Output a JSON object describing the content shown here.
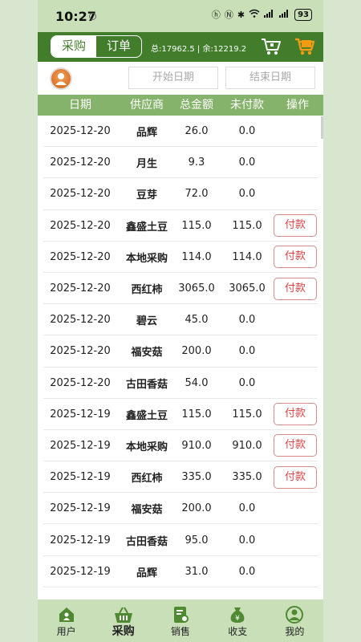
{
  "status_bar": {
    "time": "10:27",
    "battery": "93"
  },
  "header": {
    "tabs": [
      {
        "label": "采购",
        "active": true
      },
      {
        "label": "订单",
        "active": false
      }
    ],
    "summary": "总:17962.5 | 余:12219.2"
  },
  "filter": {
    "start_placeholder": "开始日期",
    "end_placeholder": "结束日期"
  },
  "table": {
    "columns": [
      "日期",
      "供应商",
      "总金额",
      "未付款",
      "操作"
    ],
    "pay_label": "付款",
    "rows": [
      {
        "date": "2025-12-20",
        "supplier": "品辉",
        "total": "26.0",
        "unpaid": "0.0",
        "pay": false
      },
      {
        "date": "2025-12-20",
        "supplier": "月生",
        "total": "9.3",
        "unpaid": "0.0",
        "pay": false
      },
      {
        "date": "2025-12-20",
        "supplier": "豆芽",
        "total": "72.0",
        "unpaid": "0.0",
        "pay": false
      },
      {
        "date": "2025-12-20",
        "supplier": "鑫盛土豆",
        "total": "115.0",
        "unpaid": "115.0",
        "pay": true
      },
      {
        "date": "2025-12-20",
        "supplier": "本地采购",
        "total": "114.0",
        "unpaid": "114.0",
        "pay": true
      },
      {
        "date": "2025-12-20",
        "supplier": "西红柿",
        "total": "3065.0",
        "unpaid": "3065.0",
        "pay": true
      },
      {
        "date": "2025-12-20",
        "supplier": "碧云",
        "total": "45.0",
        "unpaid": "0.0",
        "pay": false
      },
      {
        "date": "2025-12-20",
        "supplier": "福安菇",
        "total": "200.0",
        "unpaid": "0.0",
        "pay": false
      },
      {
        "date": "2025-12-20",
        "supplier": "古田香菇",
        "total": "54.0",
        "unpaid": "0.0",
        "pay": false
      },
      {
        "date": "2025-12-19",
        "supplier": "鑫盛土豆",
        "total": "115.0",
        "unpaid": "115.0",
        "pay": true
      },
      {
        "date": "2025-12-19",
        "supplier": "本地采购",
        "total": "910.0",
        "unpaid": "910.0",
        "pay": true
      },
      {
        "date": "2025-12-19",
        "supplier": "西红柿",
        "total": "335.0",
        "unpaid": "335.0",
        "pay": true
      },
      {
        "date": "2025-12-19",
        "supplier": "福安菇",
        "total": "200.0",
        "unpaid": "0.0",
        "pay": false
      },
      {
        "date": "2025-12-19",
        "supplier": "古田香菇",
        "total": "95.0",
        "unpaid": "0.0",
        "pay": false
      },
      {
        "date": "2025-12-19",
        "supplier": "品辉",
        "total": "31.0",
        "unpaid": "0.0",
        "pay": false
      }
    ]
  },
  "nav": {
    "items": [
      {
        "label": "用户",
        "icon": "user-house-icon",
        "active": false
      },
      {
        "label": "采购",
        "icon": "basket-icon",
        "active": true
      },
      {
        "label": "销售",
        "icon": "sales-doc-icon",
        "active": false
      },
      {
        "label": "收支",
        "icon": "money-bag-icon",
        "active": false
      },
      {
        "label": "我的",
        "icon": "profile-icon",
        "active": false
      }
    ]
  },
  "colors": {
    "header_green": "#427d2c",
    "table_header_green": "#86b36c",
    "pay_red": "#d44444",
    "nav_bg": "#c8dfb7"
  }
}
